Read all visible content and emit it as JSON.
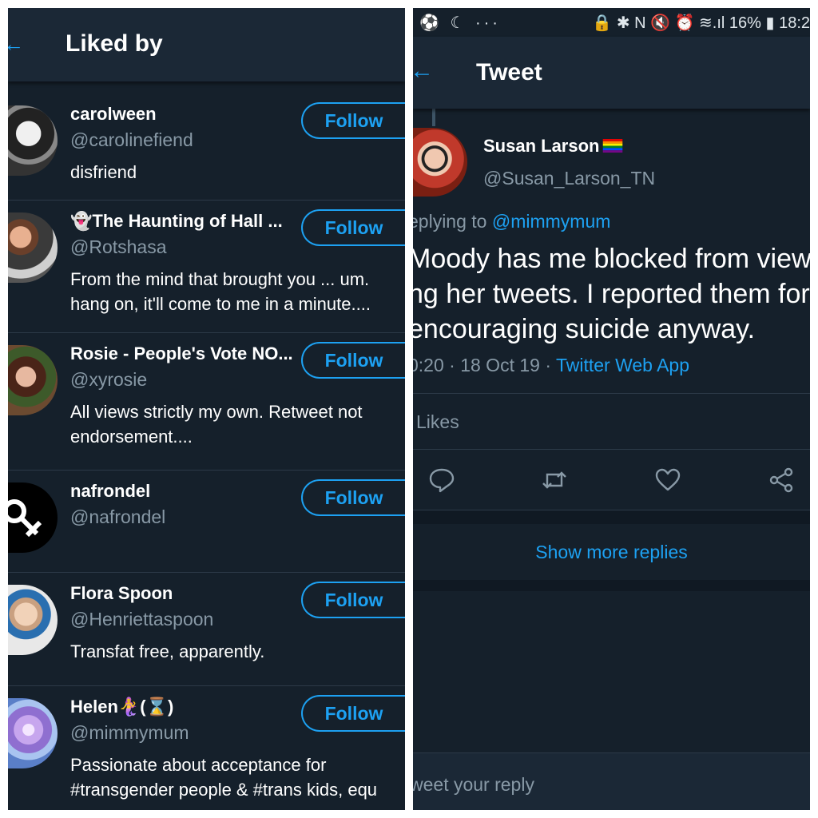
{
  "left": {
    "header": {
      "title": "Liked by"
    },
    "follow_label": "Follow",
    "users": [
      {
        "name": "carolween",
        "handle": "@carolinefiend",
        "bio": "disfriend"
      },
      {
        "name": "👻The Haunting of Hall ...",
        "handle": "@Rotshasa",
        "bio": "From the mind that brought you ... um.\nhang on, it'll come to me in a minute...."
      },
      {
        "name": "Rosie - People's Vote NO...",
        "handle": "@xyrosie",
        "bio": "All views strictly my own. Retweet not\nendorsement...."
      },
      {
        "name": "nafrondel",
        "handle": "@nafrondel",
        "bio": ""
      },
      {
        "name": "Flora Spoon",
        "handle": "@Henriettaspoon",
        "bio": "Transfat free, apparently."
      },
      {
        "name": "Helen🧜‍♀️(⌛)",
        "handle": "@mimmymum",
        "bio": "Passionate about acceptance for\n#transgender people & #trans kids, equ"
      }
    ]
  },
  "right": {
    "status": {
      "left_icons": "⚽ ☾ ···",
      "right_text": "🔒 ✱ N 🔇 ⏰ ≋.ıl 16% ▮ 18:2"
    },
    "header": {
      "title": "Tweet"
    },
    "tweet": {
      "author_name": "Susan Larson",
      "author_handle": "@Susan_Larson_TN",
      "replying_prefix": "eplying to ",
      "replying_mention": "@mimmymum",
      "text": "Moody has me blocked from view\nng her tweets. I reported them for\nencouraging suicide anyway.",
      "timestamp": "0:20 · 18 Oct 19 · ",
      "source": "Twitter Web App",
      "likes": "Likes"
    },
    "show_more": "Show more replies",
    "reply_placeholder": "weet your reply"
  },
  "colors": {
    "background": "#15202b",
    "header": "#1b2836",
    "accent": "#1da1f2",
    "muted": "#8899a6",
    "divider": "#2c3a48"
  }
}
